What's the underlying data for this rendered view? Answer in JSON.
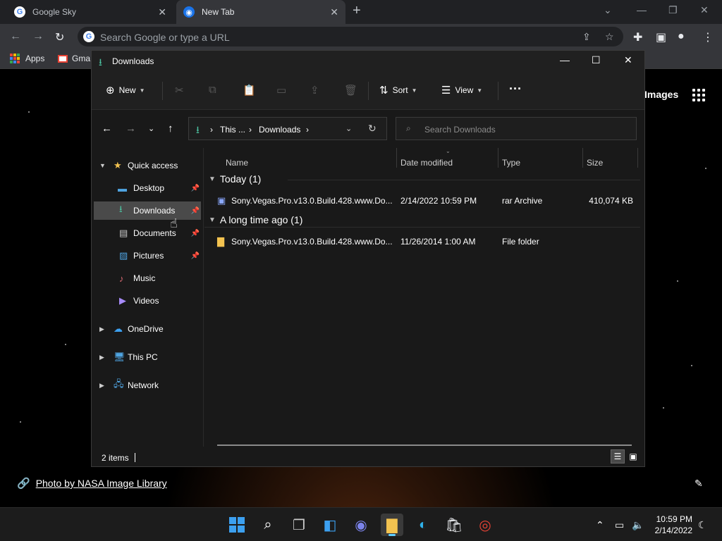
{
  "browser": {
    "tabs": [
      {
        "title": "Google Sky",
        "active": false
      },
      {
        "title": "New Tab",
        "active": true
      }
    ],
    "omnibox_placeholder": "Search Google or type a URL",
    "bookmarks": [
      {
        "label": "Apps"
      },
      {
        "label": "Gma"
      }
    ],
    "page": {
      "images_link": "Images",
      "photo_credit": "Photo by NASA Image Library"
    }
  },
  "explorer": {
    "title": "Downloads",
    "command_bar": {
      "new_label": "New",
      "sort_label": "Sort",
      "view_label": "View"
    },
    "breadcrumb": [
      "This ...",
      "Downloads"
    ],
    "search_placeholder": "Search Downloads",
    "sidebar": {
      "quick_access": "Quick access",
      "items": [
        {
          "label": "Desktop",
          "icon": "desktop-icon",
          "pinned": true
        },
        {
          "label": "Downloads",
          "icon": "download-icon",
          "pinned": true,
          "selected": true
        },
        {
          "label": "Documents",
          "icon": "document-icon",
          "pinned": true
        },
        {
          "label": "Pictures",
          "icon": "pictures-icon",
          "pinned": true
        },
        {
          "label": "Music",
          "icon": "music-icon",
          "pinned": false
        },
        {
          "label": "Videos",
          "icon": "videos-icon",
          "pinned": false
        }
      ],
      "roots": [
        {
          "label": "OneDrive",
          "icon": "cloud-icon"
        },
        {
          "label": "This PC",
          "icon": "computer-icon"
        },
        {
          "label": "Network",
          "icon": "network-icon"
        }
      ]
    },
    "columns": [
      "Name",
      "Date modified",
      "Type",
      "Size"
    ],
    "groups": [
      {
        "label": "Today (1)",
        "files": [
          {
            "name": "Sony.Vegas.Pro.v13.0.Build.428.www.Do...",
            "date": "2/14/2022 10:59 PM",
            "type": "rar Archive",
            "size": "410,074 KB",
            "icon": "rar-archive-icon"
          }
        ]
      },
      {
        "label": "A long time ago (1)",
        "files": [
          {
            "name": "Sony.Vegas.Pro.v13.0.Build.428.www.Do...",
            "date": "11/26/2014 1:00 AM",
            "type": "File folder",
            "size": "",
            "icon": "folder-icon"
          }
        ]
      }
    ],
    "status": "2 items"
  },
  "taskbar": {
    "time": "10:59 PM",
    "date": "2/14/2022"
  },
  "colors": {
    "accent": "#60cdff",
    "download_green": "#4cc2a0",
    "folder_yellow": "#f3c350",
    "explorer_bg": "#191919"
  }
}
